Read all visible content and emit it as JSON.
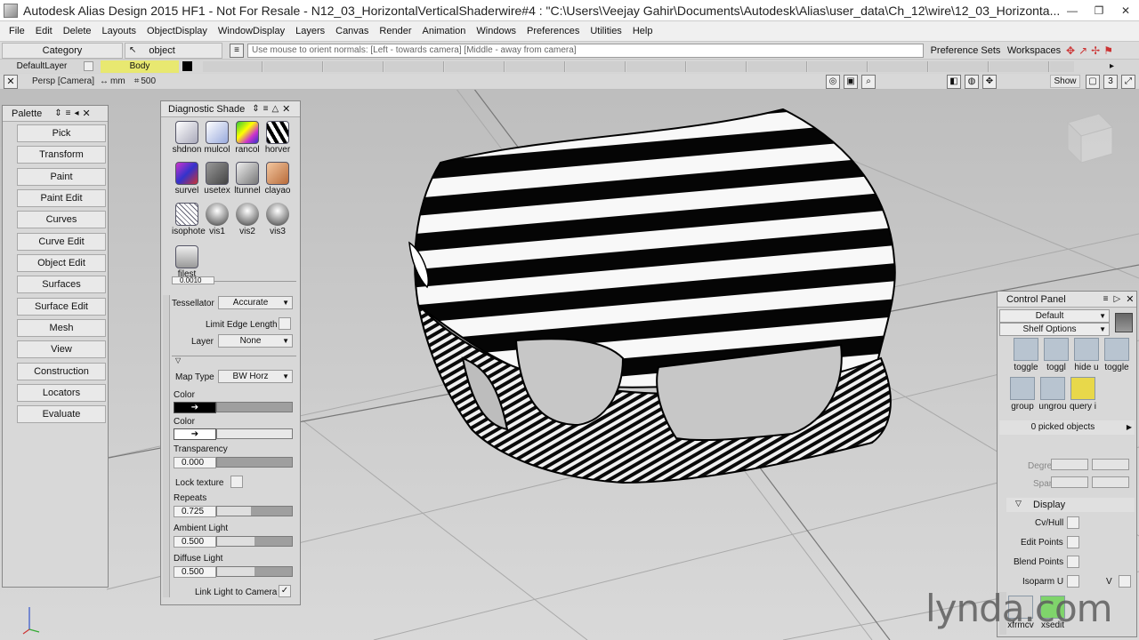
{
  "window": {
    "title": "Autodesk Alias Design 2015 HF1 - Not For Resale   - N12_03_HorizontalVerticalShaderwire#4 : \"C:\\Users\\Veejay Gahir\\Documents\\Autodesk\\Alias\\user_data\\Ch_12\\wire\\12_03_Horizonta...",
    "buttons": [
      "—",
      "❐",
      "✕"
    ]
  },
  "menu": [
    "File",
    "Edit",
    "Delete",
    "Layouts",
    "ObjectDisplay",
    "WindowDisplay",
    "Layers",
    "Canvas",
    "Render",
    "Animation",
    "Windows",
    "Preferences",
    "Utilities",
    "Help"
  ],
  "controls": {
    "category": "Category",
    "object": "object",
    "prompt": "Use mouse to orient normals: [Left - towards camera] [Middle - away from camera]",
    "preference_sets": "Preference Sets",
    "workspaces": "Workspaces"
  },
  "layers": {
    "default_layer": "DefaultLayer",
    "body_layer": "Body",
    "body_color": "#e8e870"
  },
  "viewport": {
    "label": "Persp [Camera]",
    "units": "mm",
    "scale": "500",
    "show": "Show",
    "count": "3"
  },
  "palette": {
    "title": "Palette",
    "items": [
      "Pick",
      "Transform",
      "Paint",
      "Paint Edit",
      "Curves",
      "Curve Edit",
      "Object Edit",
      "Surfaces",
      "Surface Edit",
      "Mesh",
      "View",
      "Construction",
      "Locators",
      "Evaluate"
    ]
  },
  "diagnostic": {
    "title": "Diagnostic Shade",
    "shaders": [
      "shdnon",
      "mulcol",
      "rancol",
      "horver",
      "survel",
      "usetex",
      "ltunnel",
      "clayao",
      "isophote",
      "vis1",
      "vis2",
      "vis3",
      "filest"
    ],
    "partial_value": "0.0010",
    "tessellator_label": "Tessellator",
    "tessellator_value": "Accurate",
    "limit_edge_label": "Limit Edge Length",
    "layer_label": "Layer",
    "layer_value": "None",
    "map_type_label": "Map Type",
    "map_type_value": "BW Horz",
    "color1_label": "Color",
    "color2_label": "Color",
    "transparency_label": "Transparency",
    "transparency_value": "0.000",
    "lock_texture_label": "Lock texture",
    "repeats_label": "Repeats",
    "repeats_value": "0.725",
    "ambient_label": "Ambient Light",
    "ambient_value": "0.500",
    "diffuse_label": "Diffuse Light",
    "diffuse_value": "0.500",
    "link_light_label": "Link Light to Camera"
  },
  "control_panel": {
    "title": "Control Panel",
    "preset": "Default",
    "shelf_options": "Shelf Options",
    "tools": [
      "toggle",
      "toggl",
      "hide u",
      "toggle",
      "group",
      "ungrou",
      "query i"
    ],
    "picked": "0 picked objects",
    "degree_label": "Degree",
    "spans_label": "Spans",
    "display_label": "Display",
    "cv_hull": "Cv/Hull",
    "edit_points": "Edit Points",
    "blend_points": "Blend Points",
    "isoparm": "Isoparm U",
    "isoparm_v": "V",
    "bottom_tools": [
      "xfrmcv",
      "xsedit"
    ]
  },
  "watermark": "lynda.com"
}
